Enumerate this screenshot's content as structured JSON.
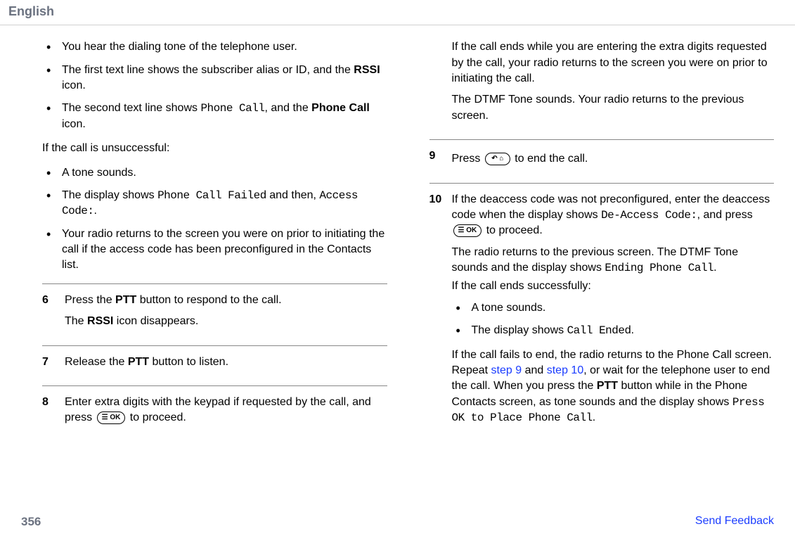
{
  "header": {
    "language": "English"
  },
  "left": {
    "bullets_a": [
      {
        "text_full": "You hear the dialing tone of the telephone user."
      },
      {
        "pre": "The first text line shows the subscriber alias or ID, and the ",
        "b": "RSSI",
        "post": " icon."
      },
      {
        "pre": "The second text line shows ",
        "m1": "Phone Call",
        "mid": ", and the ",
        "b": "Phone Call",
        "post": " icon."
      }
    ],
    "unsuccessful_intro": "If the call is unsuccessful:",
    "bullets_b": [
      {
        "text_full": "A tone sounds."
      },
      {
        "pre": "The display shows ",
        "m1": "Phone Call Failed",
        "mid": " and then, ",
        "m2": "Access Code:",
        "post": "."
      },
      {
        "text_full": "Your radio returns to the screen you were on prior to initiating the call if the access code has been preconfigured in the Contacts list."
      }
    ],
    "step6": {
      "num": "6",
      "l1_pre": "Press the ",
      "l1_b": "PTT",
      "l1_post": " button to respond to the call.",
      "l2_pre": "The ",
      "l2_b": "RSSI",
      "l2_post": " icon disappears."
    },
    "step7": {
      "num": "7",
      "pre": "Release the ",
      "b": "PTT",
      "post": " button to listen."
    },
    "step8": {
      "num": "8",
      "pre": "Enter extra digits with the keypad if requested by the call, and press ",
      "post": " to proceed."
    }
  },
  "right": {
    "para1": "If the call ends while you are entering the extra digits requested by the call, your radio returns to the screen you were on prior to initiating the call.",
    "para2": "The DTMF Tone sounds. Your radio returns to the previous screen.",
    "step9": {
      "num": "9",
      "pre": "Press ",
      "post": " to end the call."
    },
    "step10": {
      "num": "10",
      "l1_pre": "If the deaccess code was not preconfigured, enter the deaccess code when the display shows ",
      "l1_m": "De-Access Code:",
      "l1_mid": ", and press ",
      "l1_post": " to proceed.",
      "l2_pre": "The radio returns to the previous screen. The DTMF Tone sounds and the display shows ",
      "l2_m": "Ending Phone Call",
      "l2_post": ".",
      "l3": "If the call ends successfully:",
      "b1": "A tone sounds.",
      "b2_pre": "The display shows ",
      "b2_m": "Call Ended",
      "b2_post": ".",
      "tail_pre": "If the call fails to end, the radio returns to the Phone Call screen. Repeat ",
      "tail_link1": "step 9",
      "tail_mid1": " and ",
      "tail_link2": "step 10",
      "tail_mid2": ", or wait for the telephone user to end the call. When you press the ",
      "tail_b": "PTT",
      "tail_mid3": " button while in the Phone Contacts screen, as tone sounds and the display shows ",
      "tail_m": "Press OK to Place Phone Call",
      "tail_post": "."
    }
  },
  "icons": {
    "ok_label": "☰ OK",
    "home_label": "↶ ⌂"
  },
  "footer": {
    "page": "356",
    "feedback": "Send Feedback"
  }
}
